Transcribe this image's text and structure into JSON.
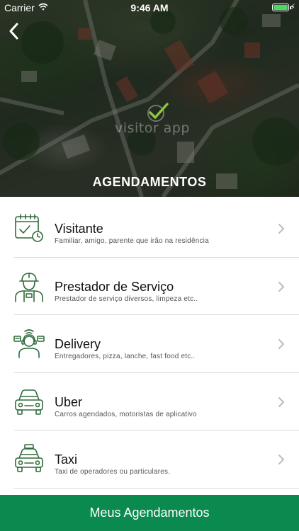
{
  "status_bar": {
    "carrier": "Carrier",
    "time": "9:46 AM"
  },
  "header": {
    "logo_text": "visitor app",
    "title": "AGENDAMENTOS"
  },
  "items": [
    {
      "title": "Visitante",
      "subtitle": "Familiar, amigo, parente que irão na residência",
      "icon": "calendar-check-icon"
    },
    {
      "title": "Prestador de Serviço",
      "subtitle": "Prestador de serviço diversos, limpeza etc..",
      "icon": "worker-icon"
    },
    {
      "title": "Delivery",
      "subtitle": "Entregadores, pizza, lanche, fast food etc..",
      "icon": "delivery-person-icon"
    },
    {
      "title": "Uber",
      "subtitle": "Carros agendados, motoristas de aplicativo",
      "icon": "car-icon"
    },
    {
      "title": "Taxi",
      "subtitle": "Taxi de operadores ou particulares.",
      "icon": "taxi-icon"
    }
  ],
  "bottom_button": {
    "label": "Meus Agendamentos"
  },
  "colors": {
    "accent_green": "#0a8a4e",
    "icon_green": "#2e6b3a",
    "check_green": "#8cc63f"
  }
}
